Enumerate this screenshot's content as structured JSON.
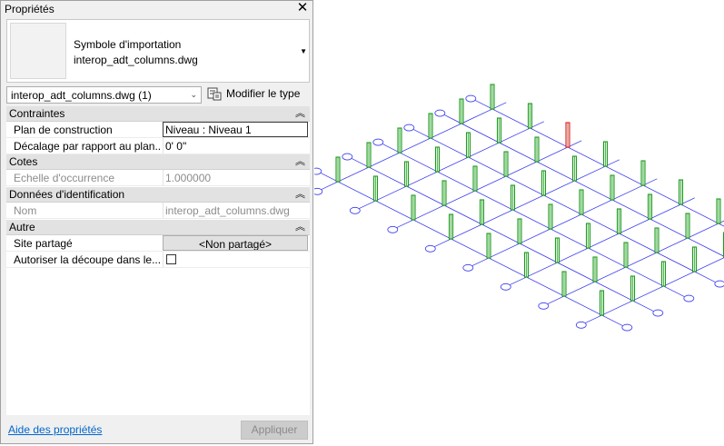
{
  "panel": {
    "title": "Propriétés",
    "close_icon": "close-icon"
  },
  "type_selector": {
    "family": "Symbole d'importation",
    "type": "interop_adt_columns.dwg"
  },
  "instance_filter": {
    "selected": "interop_adt_columns.dwg (1)"
  },
  "edit_type": {
    "label": "Modifier le type",
    "icon": "edit-type-icon"
  },
  "groups": {
    "contraintes": {
      "label": "Contraintes",
      "rows": {
        "plan": {
          "label": "Plan de construction",
          "value": "Niveau : Niveau 1"
        },
        "decalage": {
          "label": "Décalage par rapport au plan...",
          "value": "0'  0\""
        }
      }
    },
    "cotes": {
      "label": "Cotes",
      "rows": {
        "echelle": {
          "label": "Echelle d'occurrence",
          "value": "1.000000"
        }
      }
    },
    "identification": {
      "label": "Données d'identification",
      "rows": {
        "nom": {
          "label": "Nom",
          "value": "interop_adt_columns.dwg"
        }
      }
    },
    "autre": {
      "label": "Autre",
      "rows": {
        "site": {
          "label": "Site partagé",
          "value": "<Non partagé>"
        },
        "decoupe": {
          "label": "Autoriser la découpe dans le...",
          "checked": false
        }
      }
    }
  },
  "footer": {
    "help_link": "Aide des propriétés",
    "apply": "Appliquer"
  },
  "view": {
    "grid_color": "#3a3af0",
    "column_color": "#1e9b1e",
    "selected_column_color": "#e02020",
    "grid_rows": 6,
    "grid_cols": 8
  }
}
